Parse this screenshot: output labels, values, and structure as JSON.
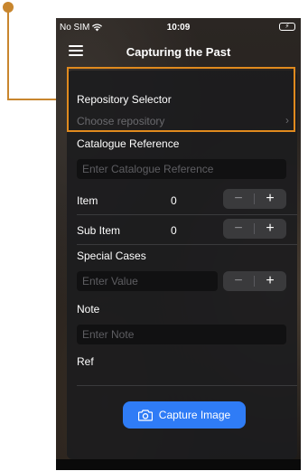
{
  "status_bar": {
    "carrier": "No SIM",
    "time": "10:09",
    "battery": "⚡"
  },
  "nav": {
    "title": "Capturing the Past"
  },
  "repository": {
    "label": "Repository Selector",
    "placeholder": "Choose repository",
    "chevron": "›"
  },
  "catalogue": {
    "label": "Catalogue Reference",
    "placeholder": "Enter Catalogue Reference"
  },
  "item": {
    "label": "Item",
    "value": "0"
  },
  "sub_item": {
    "label": "Sub Item",
    "value": "0"
  },
  "special_cases": {
    "label": "Special Cases",
    "placeholder": "Enter Value"
  },
  "note": {
    "label": "Note",
    "placeholder": "Enter Note"
  },
  "ref": {
    "label": "Ref"
  },
  "stepper": {
    "minus": "−",
    "plus": "+"
  },
  "capture": {
    "label": "Capture Image"
  },
  "colors": {
    "accent": "#2f7cf6",
    "annotation": "#e08a1e"
  },
  "icons": [
    "wifi-icon",
    "battery-icon",
    "hamburger-icon",
    "chevron-right-icon",
    "camera-icon"
  ]
}
